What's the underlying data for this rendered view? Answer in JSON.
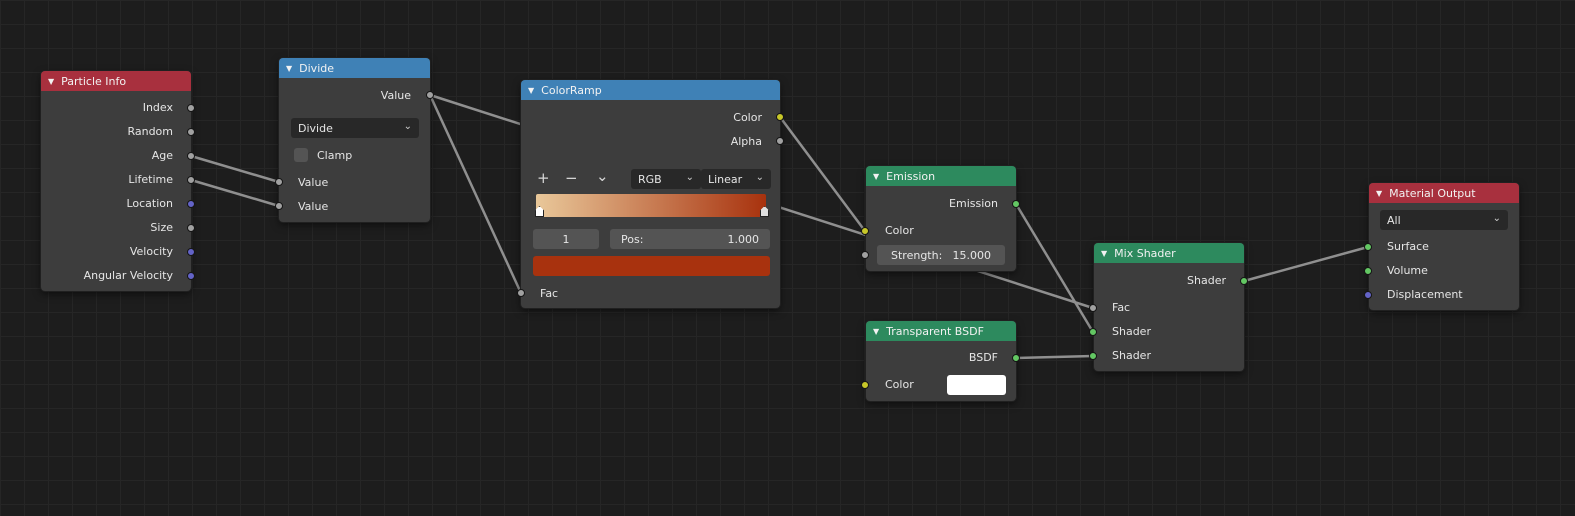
{
  "nodes": {
    "particle_info": {
      "title": "Particle Info",
      "outputs": [
        "Index",
        "Random",
        "Age",
        "Lifetime",
        "Location",
        "Size",
        "Velocity",
        "Angular Velocity"
      ]
    },
    "divide": {
      "title": "Divide",
      "output": "Value",
      "operation": "Divide",
      "clamp_label": "Clamp",
      "inputs": [
        "Value",
        "Value"
      ]
    },
    "color_ramp": {
      "title": "ColorRamp",
      "outputs": [
        "Color",
        "Alpha"
      ],
      "add_icon": "+",
      "remove_icon": "−",
      "menu_icon": "⌄",
      "color_mode": "RGB",
      "interpolation": "Linear",
      "gradient_start": "#e9c89a",
      "gradient_end": "#a8320e",
      "stop_index": "1",
      "pos_label": "Pos:",
      "pos_value": "1.000",
      "stop_color": "#a8320e",
      "input": "Fac"
    },
    "emission": {
      "title": "Emission",
      "output": "Emission",
      "color_input": "Color",
      "strength_label": "Strength:",
      "strength_value": "15.000"
    },
    "transparent_bsdf": {
      "title": "Transparent BSDF",
      "output": "BSDF",
      "color_input": "Color",
      "color_value": "#ffffff"
    },
    "mix_shader": {
      "title": "Mix Shader",
      "output": "Shader",
      "inputs": [
        "Fac",
        "Shader",
        "Shader"
      ]
    },
    "material_output": {
      "title": "Material Output",
      "target": "All",
      "inputs": [
        "Surface",
        "Volume",
        "Displacement"
      ]
    }
  },
  "colors": {
    "header_input": "#a8303e",
    "header_converter": "#3f81b6",
    "header_shader": "#2d8a5e",
    "socket_float": "#a1a1a1",
    "socket_vector": "#6363c7",
    "socket_color": "#c7c729",
    "socket_shader": "#63c763",
    "link": "#8f8f8f"
  }
}
